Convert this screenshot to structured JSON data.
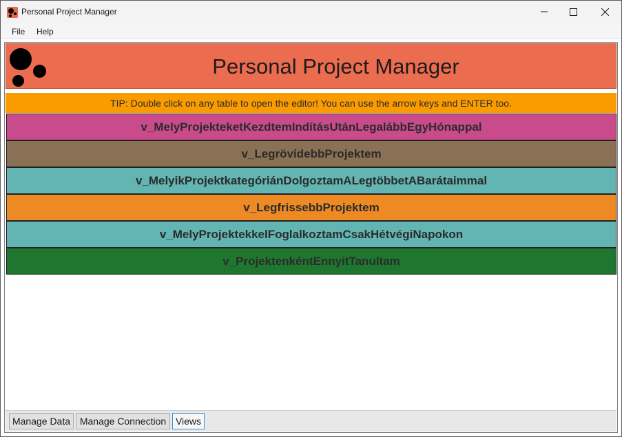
{
  "window": {
    "title": "Personal Project Manager"
  },
  "menu": {
    "items": [
      "File",
      "Help"
    ]
  },
  "header": {
    "title": "Personal Project Manager"
  },
  "tip": {
    "text": "TIP: Double click on any table to open the editor! You can use the arrow keys and ENTER too."
  },
  "views": [
    {
      "label": "v_MelyProjekteketKezdtemIndításUtánLegalábbEgyHónappal",
      "color": "#c94b8b"
    },
    {
      "label": "v_LegrövidebbProjektem",
      "color": "#8a7155"
    },
    {
      "label": "v_MelyikProjektkategóriánDolgoztamALegtöbbetABarátaimmal",
      "color": "#62b5b3"
    },
    {
      "label": "v_LegfrissebbProjektem",
      "color": "#ee8a24"
    },
    {
      "label": "v_MelyProjektekkelFoglalkoztamCsakHétvégiNapokon",
      "color": "#62b5b3"
    },
    {
      "label": "v_ProjektenkéntEnnyitTanultam",
      "color": "#1f772f"
    }
  ],
  "tabs": {
    "items": [
      "Manage Data",
      "Manage Connection",
      "Views"
    ],
    "active": "Views"
  },
  "colors": {
    "header_bg": "#ec6c4f",
    "tip_bg": "#fa9c00",
    "active_tab_border": "#3d8fd8"
  },
  "icons": {
    "app": "app-logo-icon",
    "minimize": "minimize-icon",
    "maximize": "maximize-icon",
    "close": "close-icon",
    "logo": "three-dots-logo-icon"
  }
}
